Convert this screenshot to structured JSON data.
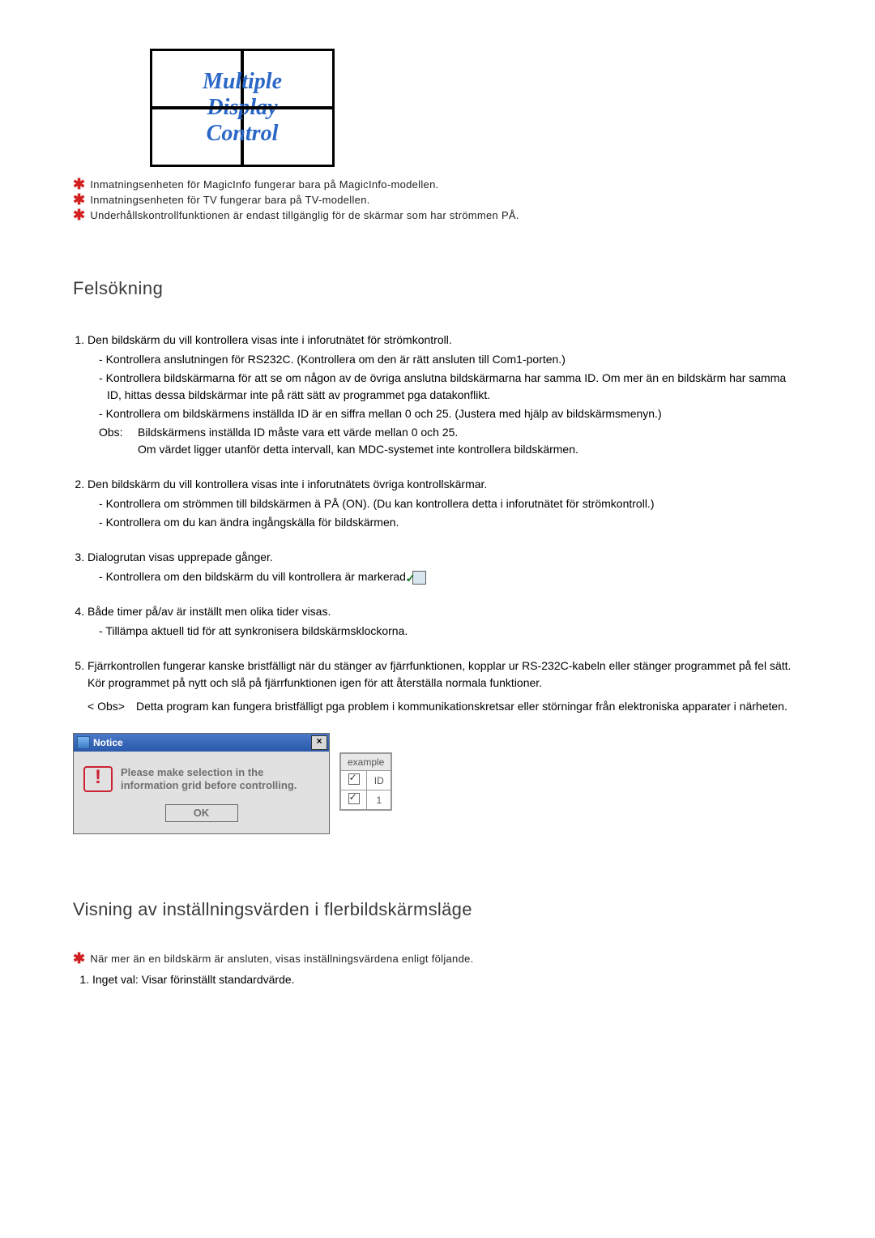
{
  "logo": {
    "line1": "Multiple",
    "line2": "Display",
    "line3": "Control"
  },
  "top_notes": [
    "Inmatningsenheten för MagicInfo fungerar bara på MagicInfo-modellen.",
    "Inmatningsenheten för TV fungerar bara på TV-modellen.",
    "Underhållskontrollfunktionen är endast tillgänglig för de skärmar som har strömmen PÅ."
  ],
  "heading_trouble": "Felsökning",
  "trouble": {
    "item1": {
      "lead": "Den bildskärm du vill kontrollera visas inte i inforutnätet för strömkontroll.",
      "subs": [
        "Kontrollera anslutningen för RS232C. (Kontrollera om den är rätt ansluten till Com1-porten.)",
        "Kontrollera bildskärmarna för att se om någon av de övriga anslutna bildskärmarna har samma ID. Om mer än en bildskärm har samma ID, hittas dessa bildskärmar inte på rätt sätt av programmet pga datakonflikt.",
        "Kontrollera om bildskärmens inställda ID är en siffra mellan 0 och 25. (Justera med hjälp av bildskärmsmenyn.)"
      ],
      "obs_label": "Obs:",
      "obs_body": "Bildskärmens inställda ID måste vara ett värde mellan 0 och 25.\nOm värdet ligger utanför detta intervall, kan MDC-systemet inte kontrollera bildskärmen."
    },
    "item2": {
      "lead": "Den bildskärm du vill kontrollera visas inte i inforutnätets övriga kontrollskärmar.",
      "subs": [
        "Kontrollera om strömmen till bildskärmen ä PÅ (ON). (Du kan kontrollera detta i inforutnätet för strömkontroll.)",
        "Kontrollera om du kan ändra ingångskälla för bildskärmen."
      ]
    },
    "item3": {
      "lead": "Dialogrutan visas upprepade gånger.",
      "subs": [
        "Kontrollera om den bildskärm du vill kontrollera är markerad."
      ]
    },
    "item4": {
      "lead": "Både timer på/av är inställt men olika tider visas.",
      "subs": [
        "Tillämpa aktuell tid för att synkronisera bildskärmsklockorna."
      ]
    },
    "item5": {
      "lead": "Fjärrkontrollen fungerar kanske bristfälligt när du stänger av fjärrfunktionen, kopplar ur RS-232C-kabeln eller stänger programmet på fel sätt. Kör programmet på nytt och slå på fjärrfunktionen igen för att återställa normala funktioner.",
      "obs_label": "< Obs>",
      "obs_body": "Detta program kan fungera bristfälligt pga problem i kommunikationskretsar eller störningar från elektroniska apparater i närheten."
    }
  },
  "notice_dialog": {
    "title": "Notice",
    "message": "Please make selection in the information grid before controlling.",
    "ok": "OK"
  },
  "example_table": {
    "header": "example",
    "id_label": "ID",
    "id_value": "1"
  },
  "heading_values": "Visning av inställningsvärden i flerbildskärmsläge",
  "values_note": "När mer än en bildskärm är ansluten, visas inställningsvärdena enligt följande.",
  "values_list": {
    "item1": "Inget val: Visar förinställt standardvärde."
  }
}
